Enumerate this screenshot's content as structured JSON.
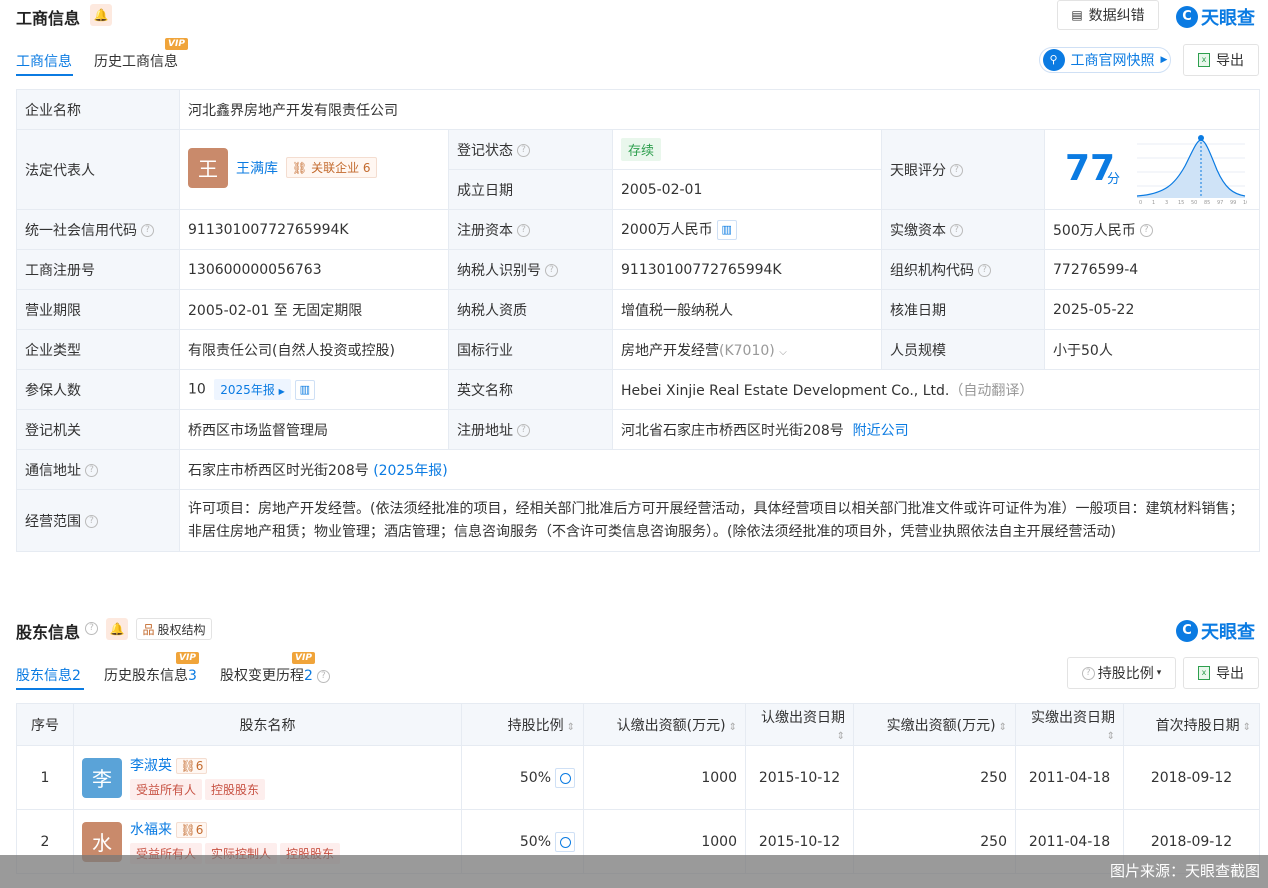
{
  "section1": {
    "title": "工商信息",
    "data_fix_label": "数据纠错",
    "brand": "天眼查",
    "tabs": [
      "工商信息",
      "历史工商信息"
    ],
    "vip": "VIP",
    "snapshot_label": "工商官网快照",
    "export_label": "导出"
  },
  "biz": {
    "company_name_label": "企业名称",
    "company_name": "河北鑫界房地产开发有限责任公司",
    "legal_rep_label": "法定代表人",
    "legal_rep_avatar": "王",
    "legal_rep_name": "王满库",
    "related_label": "关联企业",
    "related_count": "6",
    "reg_status_label": "登记状态",
    "reg_status": "存续",
    "found_date_label": "成立日期",
    "found_date": "2005-02-01",
    "score_label": "天眼评分",
    "score": "77",
    "score_unit": "分",
    "score_axis": [
      "0",
      "1",
      "3",
      "15",
      "50",
      "85",
      "97",
      "99",
      "100"
    ],
    "credit_code_label": "统一社会信用代码",
    "credit_code": "91130100772765994K",
    "reg_capital_label": "注册资本",
    "reg_capital": "2000万人民币",
    "paid_capital_label": "实缴资本",
    "paid_capital": "500万人民币",
    "reg_no_label": "工商注册号",
    "reg_no": "130600000056763",
    "taxpayer_id_label": "纳税人识别号",
    "taxpayer_id": "91130100772765994K",
    "org_code_label": "组织机构代码",
    "org_code": "77276599-4",
    "term_label": "营业期限",
    "term": "2005-02-01 至 无固定期限",
    "taxpayer_qual_label": "纳税人资质",
    "taxpayer_qual": "增值税一般纳税人",
    "approve_date_label": "核准日期",
    "approve_date": "2025-05-22",
    "type_label": "企业类型",
    "type": "有限责任公司(自然人投资或控股)",
    "industry_label": "国标行业",
    "industry": "房地产开发经营",
    "industry_code": "(K7010)",
    "staff_size_label": "人员规模",
    "staff_size": "小于50人",
    "insured_label": "参保人数",
    "insured": "10",
    "insured_year": "2025年报",
    "en_name_label": "英文名称",
    "en_name": "Hebei Xinjie Real Estate Development Co., Ltd.",
    "en_name_note": "（自动翻译）",
    "authority_label": "登记机关",
    "authority": "桥西区市场监督管理局",
    "reg_addr_label": "注册地址",
    "reg_addr": "河北省石家庄市桥西区时光街208号",
    "nearby_label": "附近公司",
    "mail_addr_label": "通信地址",
    "mail_addr": "石家庄市桥西区时光街208号",
    "mail_addr_year": "(2025年报)",
    "scope_label": "经营范围",
    "scope": "许可项目：房地产开发经营。(依法须经批准的项目，经相关部门批准后方可开展经营活动，具体经营项目以相关部门批准文件或许可证件为准）一般项目：建筑材料销售；非居住房地产租赁；物业管理；酒店管理；信息咨询服务（不含许可类信息咨询服务）。(除依法须经批准的项目外，凭营业执照依法自主开展经营活动)"
  },
  "section2": {
    "title": "股东信息",
    "equity_label": "股权结构",
    "brand": "天眼查",
    "tabs": [
      {
        "label": "股东信息",
        "count": "2"
      },
      {
        "label": "历史股东信息",
        "count": "3"
      },
      {
        "label": "股权变更历程",
        "count": "2"
      }
    ],
    "vip": "VIP",
    "ratio_btn": "持股比例",
    "export_label": "导出",
    "headers": [
      "序号",
      "股东名称",
      "持股比例",
      "认缴出资额(万元)",
      "认缴出资日期",
      "实缴出资额(万元)",
      "实缴出资日期",
      "首次持股日期"
    ],
    "rows": [
      {
        "no": "1",
        "avatar": "李",
        "name": "李淑英",
        "rel": "6",
        "tags": [
          "受益所有人",
          "控股股东"
        ],
        "ratio": "50%",
        "sub_amt": "1000",
        "sub_date": "2015-10-12",
        "paid_amt": "250",
        "paid_date": "2011-04-18",
        "first_date": "2018-09-12",
        "color": "#5aa3d8"
      },
      {
        "no": "2",
        "avatar": "水",
        "name": "水福来",
        "rel": "6",
        "tags": [
          "受益所有人",
          "实际控制人",
          "控股股东"
        ],
        "ratio": "50%",
        "sub_amt": "1000",
        "sub_date": "2015-10-12",
        "paid_amt": "250",
        "paid_date": "2011-04-18",
        "first_date": "2018-09-12",
        "color": "#c98a6b"
      }
    ]
  },
  "footer": "图片来源：天眼查截图",
  "colors": {
    "accent": "#0b7be2",
    "label_bg": "#f4f7fb",
    "border": "#e6ebf2"
  }
}
